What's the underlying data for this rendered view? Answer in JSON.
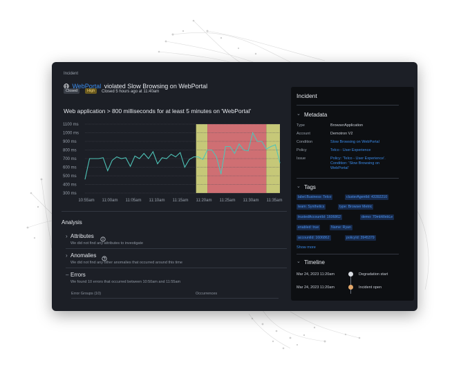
{
  "incident": {
    "label": "Incident",
    "entity": "WebPortal",
    "violation_text": "violated Slow Browsing on WebPortal",
    "status_badge": "Closed",
    "priority_badge": "High",
    "closed_text": "Closed 5 hours ago at 11:40am"
  },
  "chart_data": {
    "type": "line",
    "title": "Web application > 800 milliseconds for at least 5 minutes on 'WebPortal'",
    "y_ticks": [
      "1100 ms",
      "1000 ms",
      "900 ms",
      "800 ms",
      "700 ms",
      "600 ms",
      "500 ms",
      "400 ms",
      "300 ms"
    ],
    "x_ticks": [
      "10:55am",
      "11:00am",
      "11:05am",
      "11:10am",
      "11:15am",
      "11:20am",
      "11:25am",
      "11:30am",
      "11:35am"
    ],
    "ylim": [
      300,
      1100
    ],
    "xlim": [
      0,
      43
    ],
    "x": [
      0,
      1,
      2,
      3,
      4,
      5,
      6,
      7,
      8,
      9,
      10,
      11,
      12,
      13,
      14,
      15,
      16,
      17,
      18,
      19,
      20,
      21,
      22,
      23,
      24,
      25,
      26,
      27,
      28,
      29,
      30,
      31,
      32,
      33,
      34,
      35,
      36,
      37,
      38,
      39,
      40,
      41,
      42,
      43
    ],
    "values": [
      460,
      700,
      700,
      700,
      710,
      560,
      680,
      720,
      700,
      710,
      610,
      730,
      700,
      760,
      700,
      780,
      640,
      710,
      700,
      750,
      720,
      770,
      600,
      690,
      720,
      720,
      690,
      800,
      800,
      720,
      520,
      840,
      840,
      760,
      870,
      800,
      790,
      1000,
      900,
      900,
      810,
      840,
      860,
      650
    ],
    "bands": [
      {
        "from": 24.5,
        "to": 27,
        "color": "#c6c878"
      },
      {
        "from": 27,
        "to": 40,
        "color": "#cf6f73"
      },
      {
        "from": 40,
        "to": 43,
        "color": "#c6c878"
      }
    ]
  },
  "analysis": {
    "title": "Analysis",
    "attributes": {
      "title": "Attributes",
      "info_icon": "info-icon",
      "sub": "We did not find any attributes to investigate"
    },
    "anomalies": {
      "title": "Anomalies",
      "info_icon": "help-icon",
      "sub": "We did not find any other anomalies that occurred around this time"
    },
    "errors": {
      "title": "Errors",
      "sub": "We found 10 errors that occurred between 10:50am and 11:55am",
      "col1": "Error Groups (10)",
      "col2": "Occurrences"
    }
  },
  "side": {
    "title": "Incident",
    "metadata": {
      "title": "Metadata",
      "rows": [
        {
          "label": "Type",
          "value": "BrowserApplication"
        },
        {
          "label": "Account",
          "value": "Demotron V2"
        },
        {
          "label": "Condition",
          "value": "Slow Browsing on WebPortal"
        },
        {
          "label": "Policy",
          "value": "Telco - User Experience"
        },
        {
          "label": "Issue",
          "value": "Policy: 'Telco - User Experience'. Condition: 'Slow Browsing on WebPortal'"
        }
      ]
    },
    "tags": {
      "title": "Tags",
      "items": [
        "label.Business: Telco",
        "clusterAgentId: 43392210",
        "team: Synthetics",
        "type: Browser Metric",
        "trustedAccountId: 1606862",
        "demo: 70mbWebLe",
        "enabled: true",
        "Name: Ryan",
        "accountId: 1606862",
        "policyId: 3945379"
      ],
      "show_more": "Show more"
    },
    "timeline": {
      "title": "Timeline",
      "events": [
        {
          "date": "Mar 24, 2023 11:20am",
          "label": "Degradation start",
          "color": "#d9dde3"
        },
        {
          "date": "Mar 24, 2023 11:20am",
          "label": "Incident open",
          "color": "#e3a86b"
        }
      ]
    }
  }
}
